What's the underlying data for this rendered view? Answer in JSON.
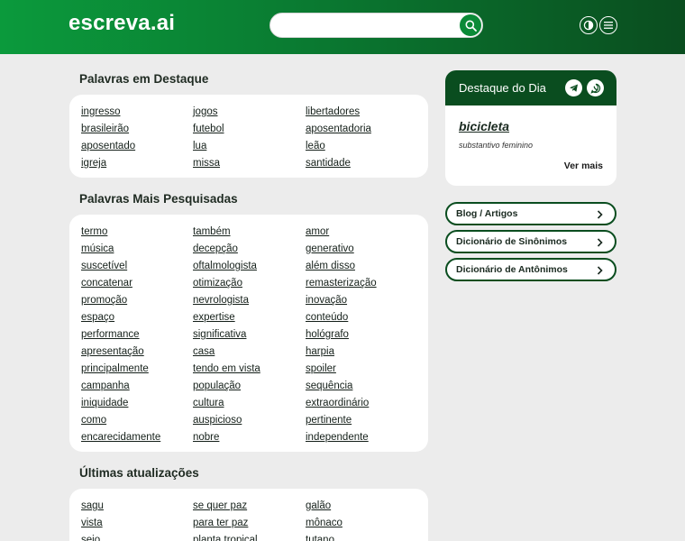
{
  "header": {
    "logo": "escreva.ai",
    "search": {
      "value": "",
      "placeholder": ""
    }
  },
  "destaque": {
    "title": "Palavras em Destaque",
    "words": [
      "ingresso",
      "jogos",
      "libertadores",
      "brasileirão",
      "futebol",
      "aposentadoria",
      "aposentado",
      "lua",
      "leão",
      "igreja",
      "missa",
      "santidade"
    ]
  },
  "pesquisadas": {
    "title": "Palavras Mais Pesquisadas",
    "words": [
      "termo",
      "também",
      "amor",
      "música",
      "decepção",
      "generativo",
      "suscetível",
      "oftalmologista",
      "além disso",
      "concatenar",
      "otimização",
      "remasterização",
      "promoção",
      "nevrologista",
      "inovação",
      "espaço",
      "expertise",
      "conteúdo",
      "performance",
      "significativa",
      "hológrafo",
      "apresentação",
      "casa",
      "harpia",
      "principalmente",
      "tendo em vista",
      "spoiler",
      "campanha",
      "população",
      "sequência",
      "iniquidade",
      "cultura",
      "extraordinário",
      "como",
      "auspicioso",
      "pertinente",
      "encarecidamente",
      "nobre",
      "independente"
    ]
  },
  "atualizacoes": {
    "title": "Últimas atualizações",
    "words": [
      "sagu",
      "se quer paz",
      "galão",
      "vista",
      "para ter paz",
      "mônaco",
      "seio",
      "planta tropical",
      "tutano"
    ]
  },
  "destaque_dia": {
    "title": "Destaque do Dia",
    "word": "bicicleta",
    "class": "substantivo feminino",
    "more": "Ver mais"
  },
  "links": [
    "Blog / Artigos",
    "Dicionário de Sinônimos",
    "Dicionário de Antônimos"
  ],
  "colors": {
    "accent": "#0b8a37",
    "dark": "#0a4d1f"
  }
}
